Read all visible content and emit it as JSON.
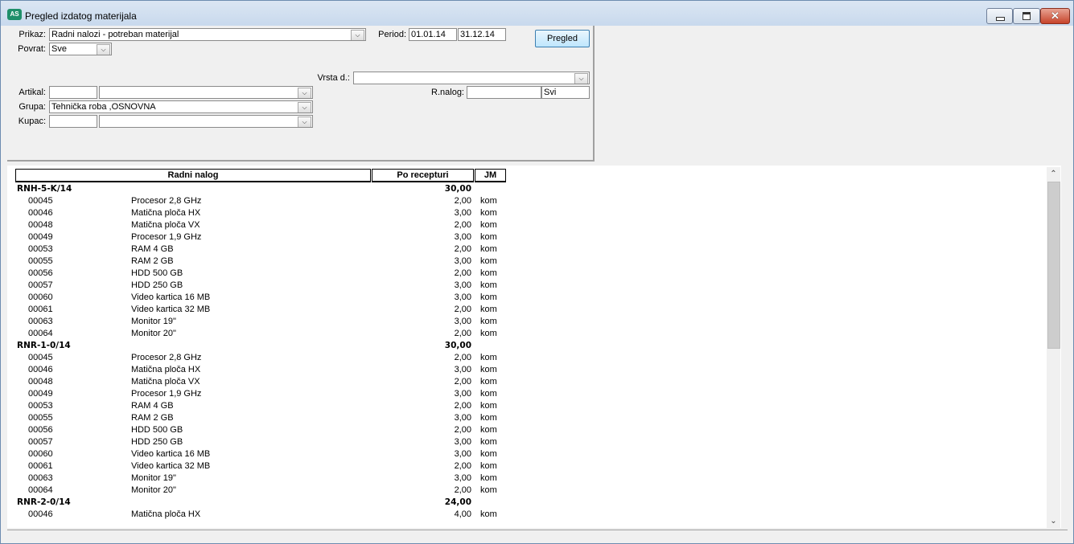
{
  "window": {
    "title": "Pregled izdatog materijala",
    "icon": "app-logo-icon",
    "close_glyph": "✕"
  },
  "filters": {
    "prikaz_label": "Prikaz:",
    "prikaz_value": "Radni nalozi - potreban materijal",
    "povrat_label": "Povrat:",
    "povrat_value": "Sve",
    "period_label": "Period:",
    "period_from": "01.01.14",
    "period_to": "31.12.14",
    "pregled_button": "Pregled",
    "vrsta_label": "Vrsta d.:",
    "vrsta_value": "",
    "artikal_label": "Artikal:",
    "artikal_code": "",
    "artikal_name": "",
    "rnalog_label": "R.nalog:",
    "rnalog_value": "",
    "rnalog_scope": "Svi",
    "grupa_label": "Grupa:",
    "grupa_value": "Tehnička roba ,OSNOVNA",
    "kupac_label": "Kupac:",
    "kupac_code": "",
    "kupac_name": ""
  },
  "table": {
    "headers": {
      "radni_nalog": "Radni nalog",
      "po_recepturi": "Po recepturi",
      "jm": "JM"
    },
    "groups": [
      {
        "name": "RNH-5-K/14",
        "total": "30,00",
        "items": [
          {
            "code": "00045",
            "name": "Procesor 2,8 GHz",
            "qty": "2,00",
            "uom": "kom"
          },
          {
            "code": "00046",
            "name": "Matična ploča HX",
            "qty": "3,00",
            "uom": "kom"
          },
          {
            "code": "00048",
            "name": "Matična ploča VX",
            "qty": "2,00",
            "uom": "kom"
          },
          {
            "code": "00049",
            "name": "Procesor 1,9 GHz",
            "qty": "3,00",
            "uom": "kom"
          },
          {
            "code": "00053",
            "name": "RAM 4 GB",
            "qty": "2,00",
            "uom": "kom"
          },
          {
            "code": "00055",
            "name": "RAM 2 GB",
            "qty": "3,00",
            "uom": "kom"
          },
          {
            "code": "00056",
            "name": "HDD 500 GB",
            "qty": "2,00",
            "uom": "kom"
          },
          {
            "code": "00057",
            "name": "HDD 250 GB",
            "qty": "3,00",
            "uom": "kom"
          },
          {
            "code": "00060",
            "name": "Video kartica 16 MB",
            "qty": "3,00",
            "uom": "kom"
          },
          {
            "code": "00061",
            "name": "Video kartica 32 MB",
            "qty": "2,00",
            "uom": "kom"
          },
          {
            "code": "00063",
            "name": "Monitor 19\"",
            "qty": "3,00",
            "uom": "kom"
          },
          {
            "code": "00064",
            "name": "Monitor 20\"",
            "qty": "2,00",
            "uom": "kom"
          }
        ]
      },
      {
        "name": "RNR-1-0/14",
        "total": "30,00",
        "items": [
          {
            "code": "00045",
            "name": "Procesor 2,8 GHz",
            "qty": "2,00",
            "uom": "kom"
          },
          {
            "code": "00046",
            "name": "Matična ploča HX",
            "qty": "3,00",
            "uom": "kom"
          },
          {
            "code": "00048",
            "name": "Matična ploča VX",
            "qty": "2,00",
            "uom": "kom"
          },
          {
            "code": "00049",
            "name": "Procesor 1,9 GHz",
            "qty": "3,00",
            "uom": "kom"
          },
          {
            "code": "00053",
            "name": "RAM 4 GB",
            "qty": "2,00",
            "uom": "kom"
          },
          {
            "code": "00055",
            "name": "RAM 2 GB",
            "qty": "3,00",
            "uom": "kom"
          },
          {
            "code": "00056",
            "name": "HDD 500 GB",
            "qty": "2,00",
            "uom": "kom"
          },
          {
            "code": "00057",
            "name": "HDD 250 GB",
            "qty": "3,00",
            "uom": "kom"
          },
          {
            "code": "00060",
            "name": "Video kartica 16 MB",
            "qty": "3,00",
            "uom": "kom"
          },
          {
            "code": "00061",
            "name": "Video kartica 32 MB",
            "qty": "2,00",
            "uom": "kom"
          },
          {
            "code": "00063",
            "name": "Monitor 19\"",
            "qty": "3,00",
            "uom": "kom"
          },
          {
            "code": "00064",
            "name": "Monitor 20\"",
            "qty": "2,00",
            "uom": "kom"
          }
        ]
      },
      {
        "name": "RNR-2-0/14",
        "total": "24,00",
        "items": [
          {
            "code": "00046",
            "name": "Matična ploča HX",
            "qty": "4,00",
            "uom": "kom"
          }
        ]
      }
    ]
  },
  "scrollbar": {
    "up_glyph": "⌃",
    "down_glyph": "⌄"
  }
}
